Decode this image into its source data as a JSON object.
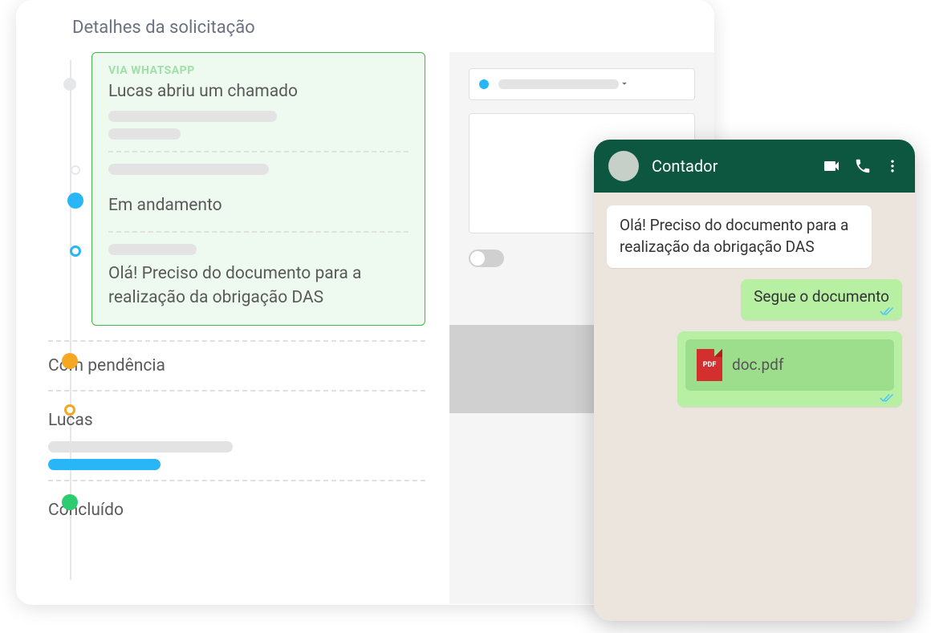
{
  "details": {
    "header_title": "Detalhes da solicitação",
    "highlight": {
      "source_label": "VIA WHATSAPP",
      "title": "Lucas abriu um chamado",
      "message": "Olá! Preciso do documento para a realização da obrigação DAS"
    },
    "statuses": {
      "in_progress": "Em andamento",
      "pending": "Com pendência",
      "lucas": "Lucas",
      "done": "Concluído"
    }
  },
  "chat": {
    "contact_name": "Contador",
    "incoming_message": "Olá! Preciso do documento para a realização da obrigação DAS",
    "outgoing_message": "Segue o documento",
    "attachment": {
      "badge": "PDF",
      "file_name": "doc.pdf"
    }
  }
}
